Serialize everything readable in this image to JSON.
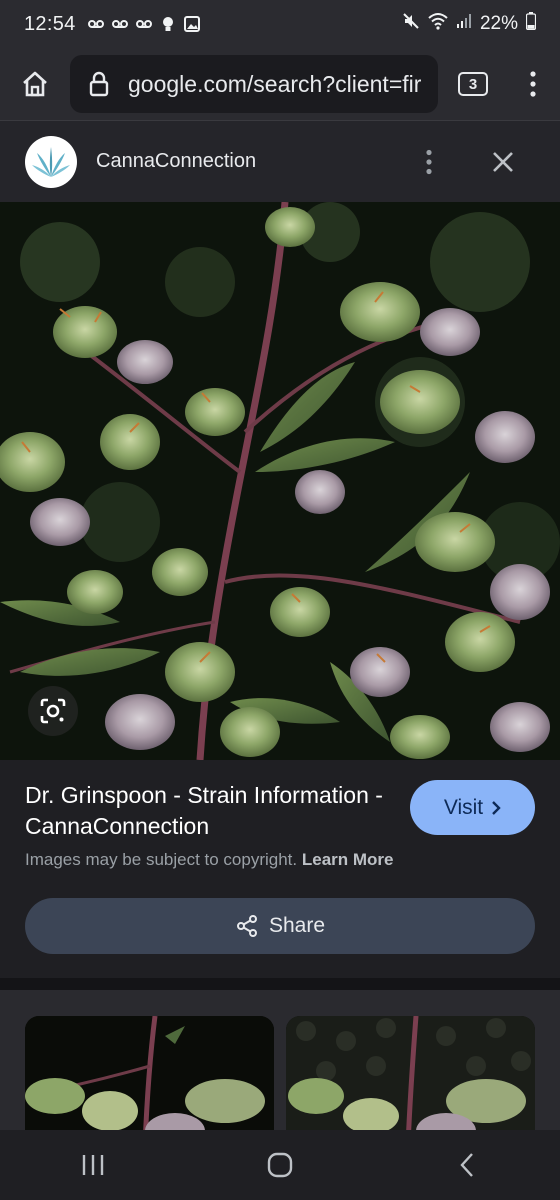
{
  "status_bar": {
    "time": "12:54",
    "battery": "22%",
    "notification_icons": [
      "voicemail-icon",
      "voicemail-icon",
      "voicemail-icon",
      "bulb-icon",
      "image-icon"
    ],
    "right_icons": [
      "mute-icon",
      "wifi-icon",
      "signal-icon",
      "battery-icon"
    ]
  },
  "browser": {
    "url": "google.com/search?client=fir",
    "tab_count": "3"
  },
  "site": {
    "name": "CannaConnection"
  },
  "result": {
    "title": "Dr. Grinspoon - Strain Information - CannaConnection",
    "visit_label": "Visit",
    "copyright_text": "Images may be subject to copyright.",
    "learn_more": "Learn More",
    "share_label": "Share"
  },
  "colors": {
    "visit_button": "#8ab4f8",
    "share_button": "#3c4556",
    "background": "#1f1f23"
  }
}
